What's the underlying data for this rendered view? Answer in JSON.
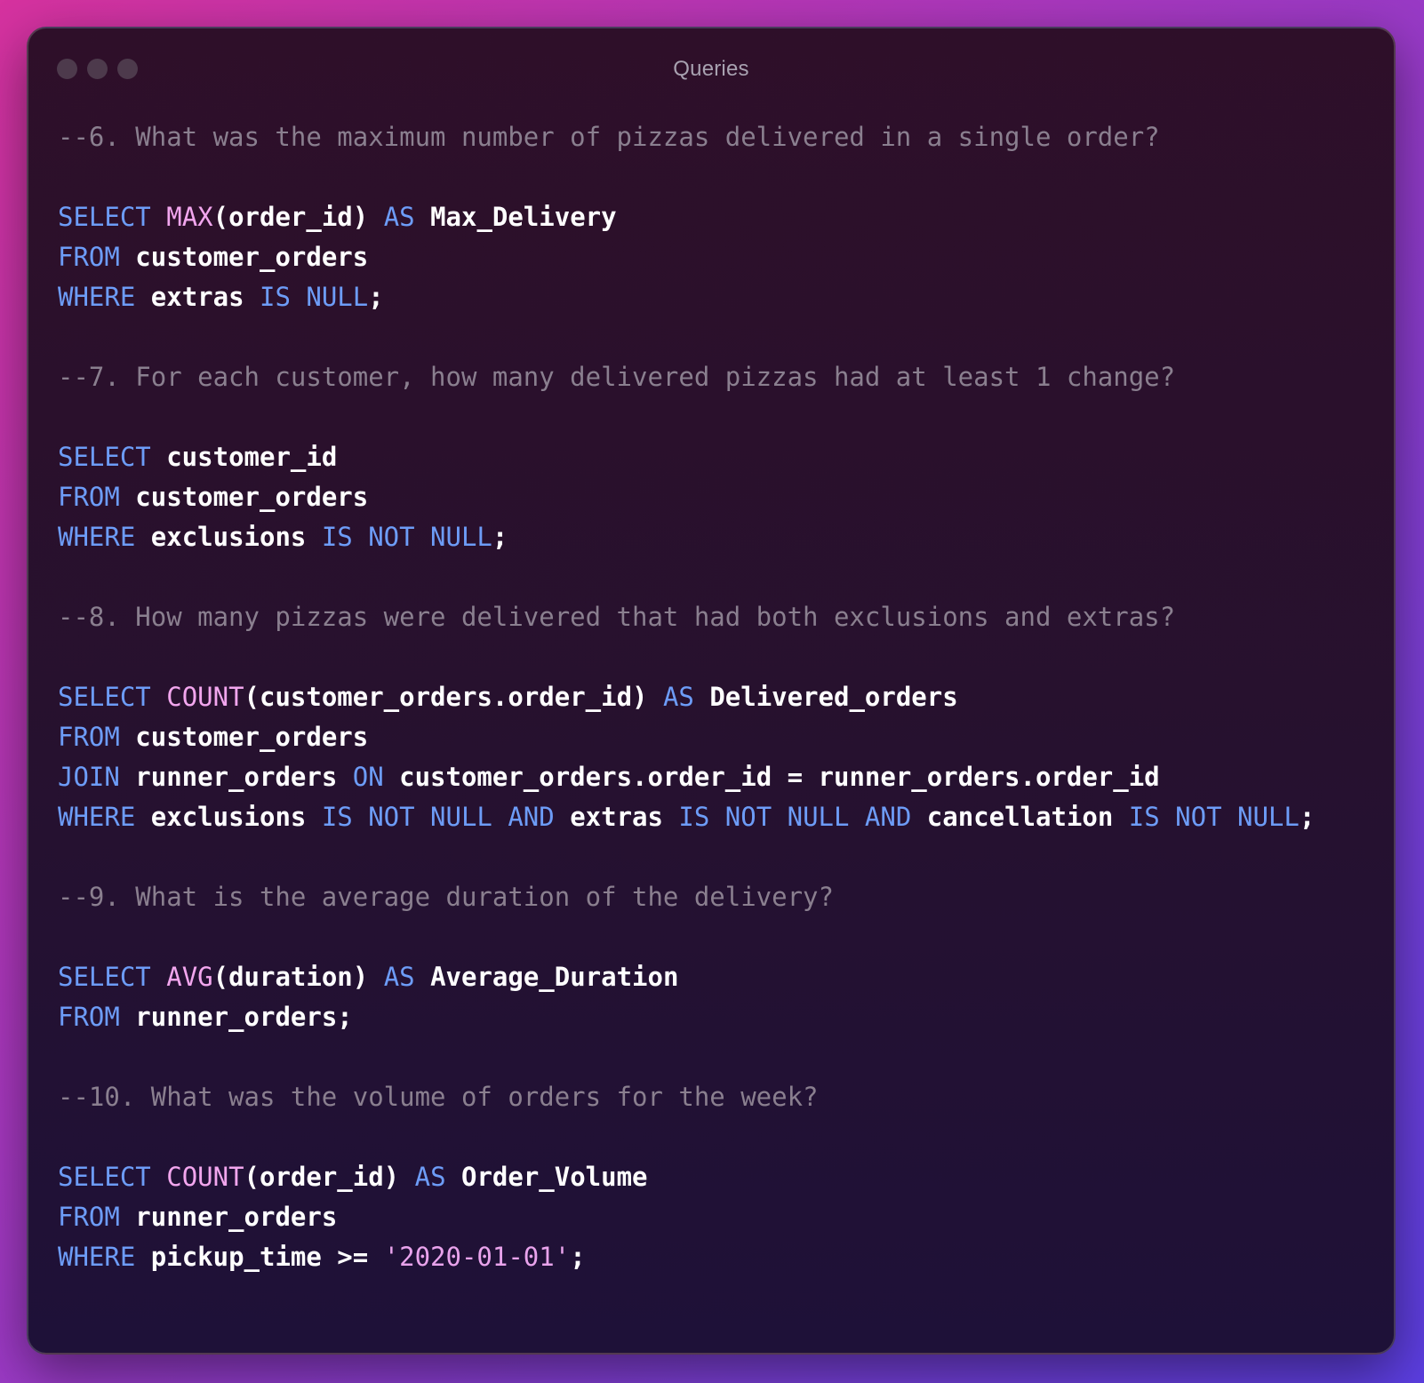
{
  "window": {
    "title": "Queries"
  },
  "code_lines": [
    [
      {
        "t": "comment",
        "v": "--6. What was the maximum number of pizzas delivered in a single order?"
      }
    ],
    [],
    [
      {
        "t": "kw",
        "v": "SELECT"
      },
      {
        "t": "pl",
        "v": " "
      },
      {
        "t": "fn",
        "v": "MAX"
      },
      {
        "t": "pl",
        "v": "(order_id) "
      },
      {
        "t": "kw",
        "v": "AS"
      },
      {
        "t": "pl",
        "v": " Max_Delivery"
      }
    ],
    [
      {
        "t": "kw",
        "v": "FROM"
      },
      {
        "t": "pl",
        "v": " customer_orders"
      }
    ],
    [
      {
        "t": "kw",
        "v": "WHERE"
      },
      {
        "t": "pl",
        "v": " extras "
      },
      {
        "t": "kw",
        "v": "IS NULL"
      },
      {
        "t": "pl",
        "v": ";"
      }
    ],
    [],
    [
      {
        "t": "comment",
        "v": "--7. For each customer, how many delivered pizzas had at least 1 change?"
      }
    ],
    [],
    [
      {
        "t": "kw",
        "v": "SELECT"
      },
      {
        "t": "pl",
        "v": " customer_id"
      }
    ],
    [
      {
        "t": "kw",
        "v": "FROM"
      },
      {
        "t": "pl",
        "v": " customer_orders"
      }
    ],
    [
      {
        "t": "kw",
        "v": "WHERE"
      },
      {
        "t": "pl",
        "v": " exclusions "
      },
      {
        "t": "kw",
        "v": "IS NOT NULL"
      },
      {
        "t": "pl",
        "v": ";"
      }
    ],
    [],
    [
      {
        "t": "comment",
        "v": "--8. How many pizzas were delivered that had both exclusions and extras?"
      }
    ],
    [],
    [
      {
        "t": "kw",
        "v": "SELECT"
      },
      {
        "t": "pl",
        "v": " "
      },
      {
        "t": "fn",
        "v": "COUNT"
      },
      {
        "t": "pl",
        "v": "(customer_orders.order_id) "
      },
      {
        "t": "kw",
        "v": "AS"
      },
      {
        "t": "pl",
        "v": " Delivered_orders"
      }
    ],
    [
      {
        "t": "kw",
        "v": "FROM"
      },
      {
        "t": "pl",
        "v": " customer_orders"
      }
    ],
    [
      {
        "t": "kw",
        "v": "JOIN"
      },
      {
        "t": "pl",
        "v": " runner_orders "
      },
      {
        "t": "kw",
        "v": "ON"
      },
      {
        "t": "pl",
        "v": " customer_orders.order_id = runner_orders.order_id"
      }
    ],
    [
      {
        "t": "kw",
        "v": "WHERE"
      },
      {
        "t": "pl",
        "v": " exclusions "
      },
      {
        "t": "kw",
        "v": "IS NOT NULL AND"
      },
      {
        "t": "pl",
        "v": " extras "
      },
      {
        "t": "kw",
        "v": "IS NOT NULL AND"
      },
      {
        "t": "pl",
        "v": " cancellation "
      },
      {
        "t": "kw",
        "v": "IS NOT NULL"
      },
      {
        "t": "pl",
        "v": ";"
      }
    ],
    [],
    [
      {
        "t": "comment",
        "v": "--9. What is the average duration of the delivery?"
      }
    ],
    [],
    [
      {
        "t": "kw",
        "v": "SELECT"
      },
      {
        "t": "pl",
        "v": " "
      },
      {
        "t": "fn",
        "v": "AVG"
      },
      {
        "t": "pl",
        "v": "(duration) "
      },
      {
        "t": "kw",
        "v": "AS"
      },
      {
        "t": "pl",
        "v": " Average_Duration"
      }
    ],
    [
      {
        "t": "kw",
        "v": "FROM"
      },
      {
        "t": "pl",
        "v": " runner_orders;"
      }
    ],
    [],
    [
      {
        "t": "comment",
        "v": "--10. What was the volume of orders for the week?"
      }
    ],
    [],
    [
      {
        "t": "kw",
        "v": "SELECT"
      },
      {
        "t": "pl",
        "v": " "
      },
      {
        "t": "fn",
        "v": "COUNT"
      },
      {
        "t": "pl",
        "v": "(order_id) "
      },
      {
        "t": "kw",
        "v": "AS"
      },
      {
        "t": "pl",
        "v": " Order_Volume"
      }
    ],
    [
      {
        "t": "kw",
        "v": "FROM"
      },
      {
        "t": "pl",
        "v": " runner_orders"
      }
    ],
    [
      {
        "t": "kw",
        "v": "WHERE"
      },
      {
        "t": "pl",
        "v": " pickup_time >= "
      },
      {
        "t": "str",
        "v": "'2020-01-01'"
      },
      {
        "t": "pl",
        "v": ";"
      }
    ]
  ],
  "colors": {
    "keyword": "#6d9cf7",
    "function": "#f2a6ee",
    "string": "#e9a3ec",
    "comment": "#8a7f8f",
    "plain": "#ffffff"
  }
}
